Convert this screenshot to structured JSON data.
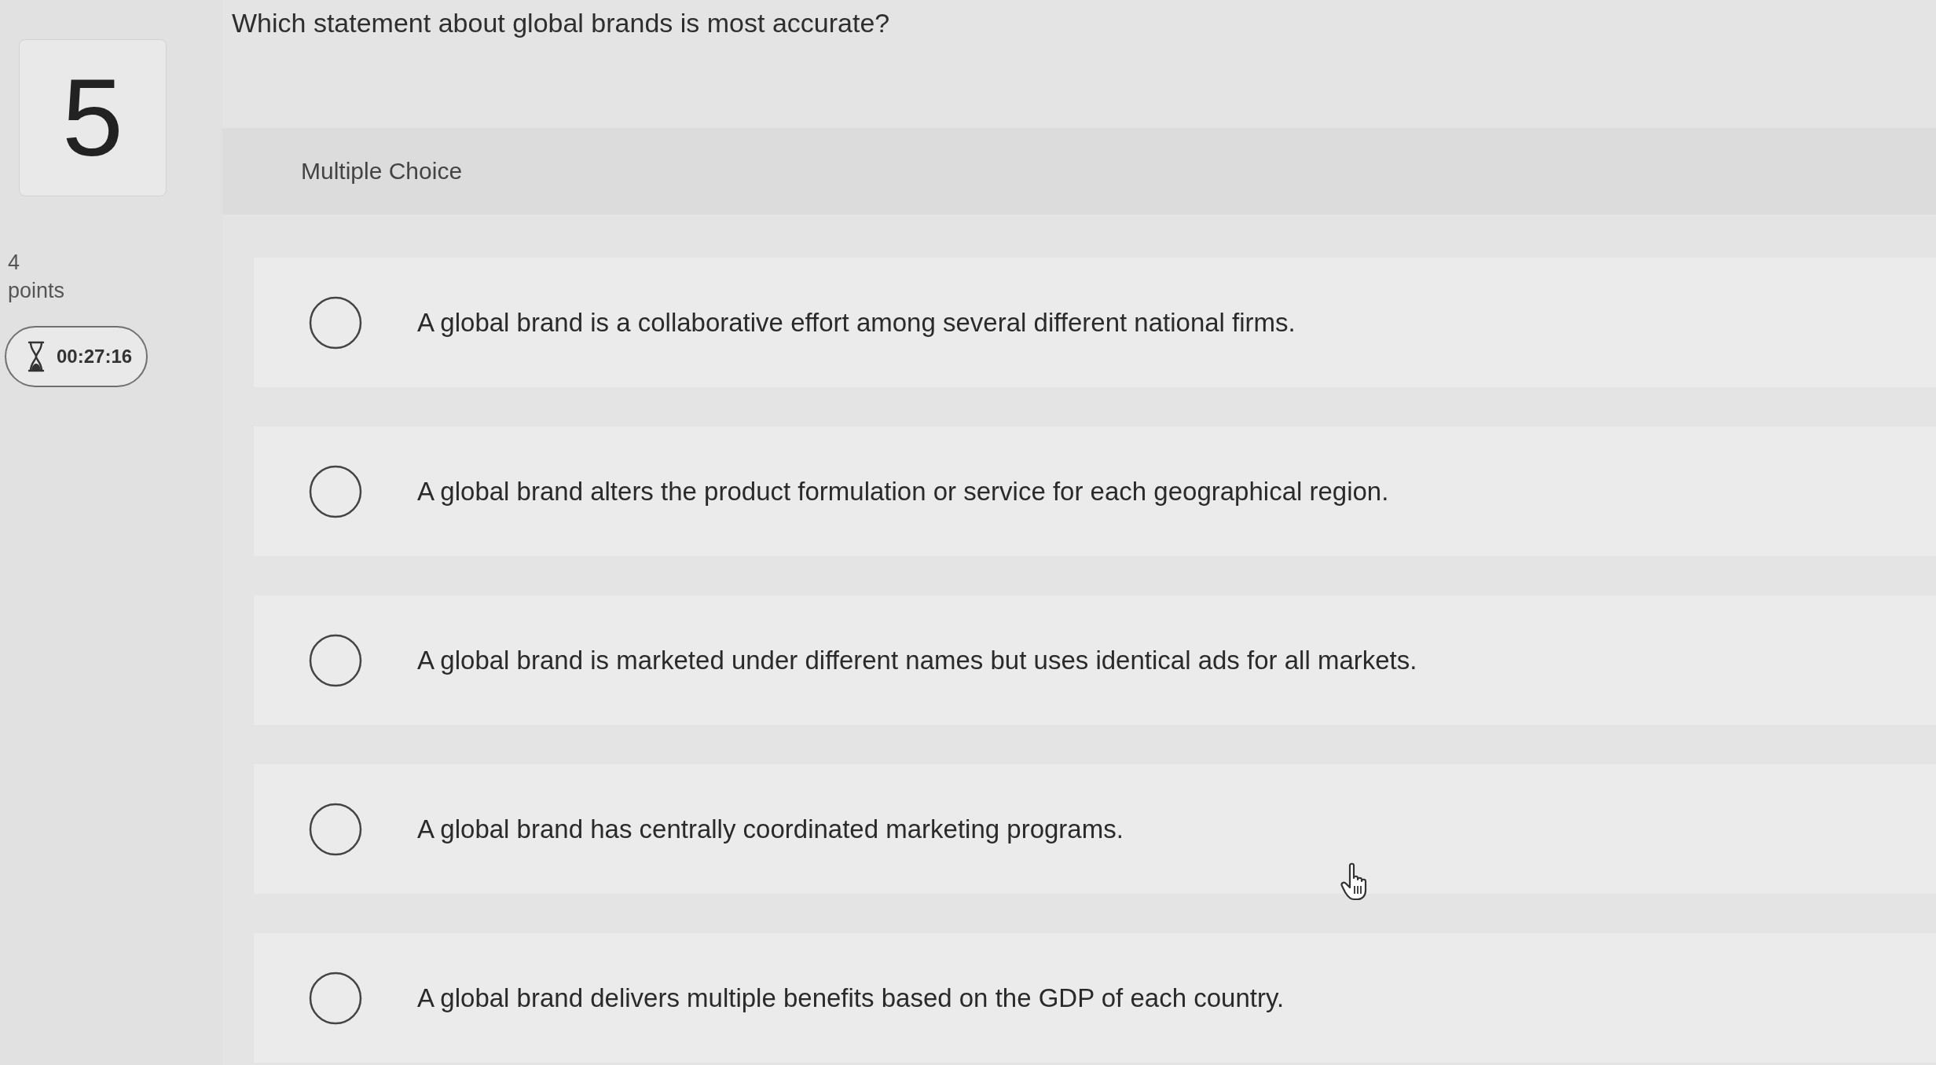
{
  "question": {
    "number": "5",
    "points_value": "4",
    "points_label": "points",
    "timer": "00:27:16",
    "text": "Which statement about global brands is most accurate?",
    "type_label": "Multiple Choice"
  },
  "options": [
    {
      "label": "A global brand is a collaborative effort among several different national firms.",
      "selected": false
    },
    {
      "label": "A global brand alters the product formulation or service for each geographical region.",
      "selected": false
    },
    {
      "label": "A global brand is marketed under different names but uses identical ads for all markets.",
      "selected": false
    },
    {
      "label": "A global brand has centrally coordinated marketing programs.",
      "selected": false
    },
    {
      "label": "A global brand delivers multiple benefits based on the GDP of each country.",
      "selected": false
    }
  ]
}
